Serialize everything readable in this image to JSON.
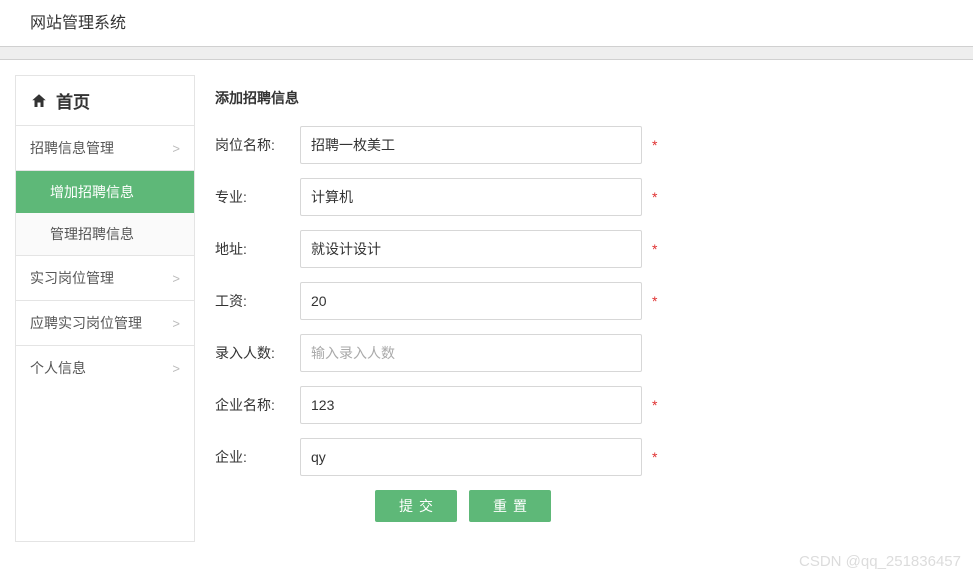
{
  "header": {
    "title": "网站管理系统"
  },
  "sidebar": {
    "home_label": "首页",
    "items": [
      {
        "label": "招聘信息管理",
        "expanded": true,
        "children": [
          {
            "label": "增加招聘信息",
            "active": true
          },
          {
            "label": "管理招聘信息",
            "active": false
          }
        ]
      },
      {
        "label": "实习岗位管理",
        "expanded": false
      },
      {
        "label": "应聘实习岗位管理",
        "expanded": false
      },
      {
        "label": "个人信息",
        "expanded": false
      }
    ]
  },
  "main": {
    "title": "添加招聘信息",
    "fields": {
      "position": {
        "label": "岗位名称:",
        "value": "招聘一枚美工",
        "placeholder": "",
        "required": true
      },
      "major": {
        "label": "专业:",
        "value": "计算机",
        "placeholder": "",
        "required": true
      },
      "address": {
        "label": "地址:",
        "value": "就设计设计",
        "placeholder": "",
        "required": true
      },
      "salary": {
        "label": "工资:",
        "value": "20",
        "placeholder": "",
        "required": true
      },
      "count": {
        "label": "录入人数:",
        "value": "",
        "placeholder": "输入录入人数",
        "required": false
      },
      "company": {
        "label": "企业名称:",
        "value": "123",
        "placeholder": "",
        "required": true
      },
      "enterprise": {
        "label": "企业:",
        "value": "qy",
        "placeholder": "",
        "required": true
      }
    },
    "buttons": {
      "submit": "提交",
      "reset": "重置"
    },
    "required_mark": "*"
  },
  "watermark": "CSDN @qq_251836457"
}
